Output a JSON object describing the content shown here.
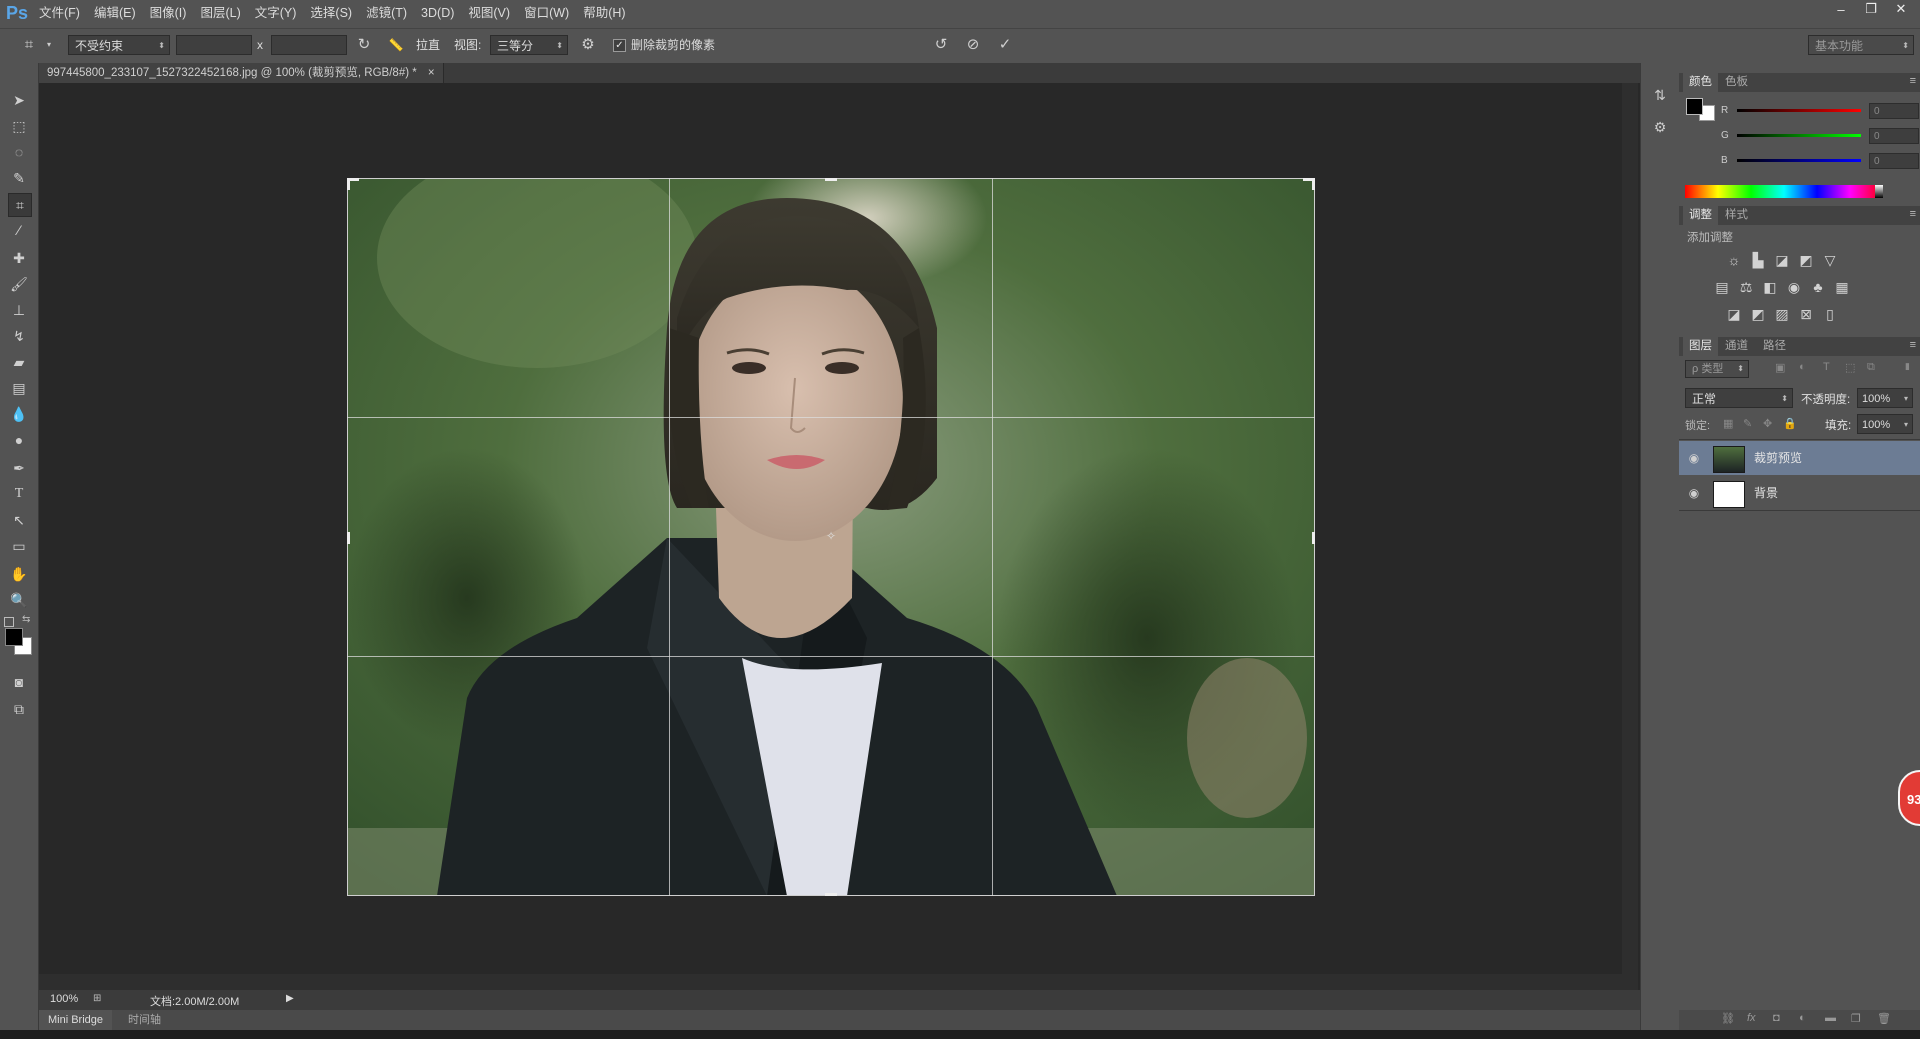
{
  "app": {
    "logo": "Ps"
  },
  "menu": [
    "文件(F)",
    "编辑(E)",
    "图像(I)",
    "图层(L)",
    "文字(Y)",
    "选择(S)",
    "滤镜(T)",
    "3D(D)",
    "视图(V)",
    "窗口(W)",
    "帮助(H)"
  ],
  "window_controls": {
    "minimize": "–",
    "restore": "❐",
    "close": "✕"
  },
  "options": {
    "ratio_preset": "不受约束",
    "times": "x",
    "straighten_label": "拉直",
    "view_label": "视图:",
    "view_value": "三等分",
    "delete_pixels_label": "删除裁剪的像素",
    "delete_pixels_checked": true,
    "workspace": "基本功能"
  },
  "document": {
    "tab_title": "997445800_233107_1527322452168.jpg @ 100% (裁剪预览, RGB/8#) *",
    "close": "×"
  },
  "status": {
    "zoom": "100%",
    "doc_size": "文档:2.00M/2.00M"
  },
  "bottom_tabs": [
    "Mini Bridge",
    "时间轴"
  ],
  "panels": {
    "color_tabs": [
      "颜色",
      "色板"
    ],
    "rgb_labels": [
      "R",
      "G",
      "B"
    ],
    "rgb_values": [
      "0",
      "0",
      "0"
    ],
    "adjust_tabs": [
      "调整",
      "样式"
    ],
    "adjust_title": "添加调整",
    "layer_tabs": [
      "图层",
      "通道",
      "路径"
    ],
    "kind_filter": "ρ 类型",
    "blend_mode": "正常",
    "opacity_label": "不透明度:",
    "opacity_value": "100%",
    "lock_label": "锁定:",
    "fill_label": "填充:",
    "fill_value": "100%",
    "layers": [
      {
        "name": "裁剪预览",
        "selected": true
      },
      {
        "name": "背景",
        "selected": false
      }
    ]
  },
  "notification_badge": "93"
}
